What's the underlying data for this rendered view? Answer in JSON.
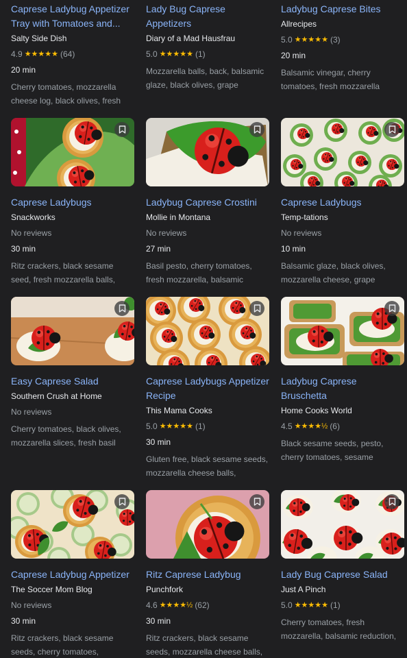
{
  "colors": {
    "background": "#1f1f21",
    "title": "#8ab4f8",
    "star": "#fbbc04",
    "muted": "#9aa0a6"
  },
  "recipes": [
    {
      "title": "Caprese Ladybug Appetizer Tray with Tomatoes and...",
      "source": "Salty Side Dish",
      "rating": "4.9",
      "stars": "★★★★★",
      "reviews": "(64)",
      "time": "20 min",
      "ingredients": "Cherry tomatoes, mozzarella cheese log, black olives, fresh",
      "image": "none"
    },
    {
      "title": "Lady Bug Caprese Appetizers",
      "source": "Diary of a Mad Hausfrau",
      "rating": "5.0",
      "stars": "★★★★★",
      "reviews": "(1)",
      "time": "",
      "ingredients": "Mozzarella balls, back, balsamic glaze, black olives, grape",
      "image": "none"
    },
    {
      "title": "Ladybug Caprese Bites",
      "source": "Allrecipes",
      "rating": "5.0",
      "stars": "★★★★★",
      "reviews": "(3)",
      "time": "20 min",
      "ingredients": "Balsamic vinegar, cherry tomatoes, fresh mozzarella",
      "image": "none"
    },
    {
      "title": "Caprese Ladybugs",
      "source": "Snackworks",
      "no_reviews": "No reviews",
      "time": "30 min",
      "ingredients": "Ritz crackers, black sesame seed, fresh mozzarella balls,",
      "image": "crackers-basil"
    },
    {
      "title": "Ladybug Caprese Crostini",
      "source": "Mollie in Montana",
      "no_reviews": "No reviews",
      "time": "27 min",
      "ingredients": "Basil pesto, cherry tomatoes, fresh mozzarella, balsamic",
      "image": "crostini-closeup"
    },
    {
      "title": "Caprese Ladybugs",
      "source": "Temp-tations",
      "no_reviews": "No reviews",
      "time": "10 min",
      "ingredients": "Balsamic glaze, black olives, mozzarella cheese, grape",
      "image": "platter-many"
    },
    {
      "title": "Easy Caprese Salad",
      "source": "Southern Crush at Home",
      "no_reviews": "No reviews",
      "time": "",
      "ingredients": "Cherry tomatoes, black olives, mozzarella slices, fresh basil",
      "image": "wood-board"
    },
    {
      "title": "Caprese Ladybugs Appetizer Recipe",
      "source": "This Mama Cooks",
      "rating": "5.0",
      "stars": "★★★★★",
      "reviews": "(1)",
      "time": "30 min",
      "ingredients": "Gluten free, black sesame seeds, mozzarella cheese balls,",
      "image": "crackers-yellow"
    },
    {
      "title": "Ladybug Caprese Bruschetta",
      "source": "Home Cooks World",
      "rating": "4.5",
      "stars": "★★★★½",
      "reviews": "(6)",
      "time": "",
      "ingredients": "Black sesame seeds, pesto, cherry tomatoes, sesame",
      "image": "bruschetta"
    },
    {
      "title": "Caprese Ladybug Appetizer",
      "source": "The Soccer Mom Blog",
      "no_reviews": "No reviews",
      "time": "30 min",
      "ingredients": "Ritz crackers, black sesame seeds, cherry tomatoes,",
      "image": "cucumber"
    },
    {
      "title": "Ritz Caprese Ladybug",
      "source": "Punchfork",
      "rating": "4.6",
      "stars": "★★★★½",
      "reviews": "(62)",
      "time": "30 min",
      "ingredients": "Ritz crackers, black sesame seeds, mozzarella cheese balls,",
      "image": "pink-cracker"
    },
    {
      "title": "Lady Bug Caprese Salad",
      "source": "Just A Pinch",
      "rating": "5.0",
      "stars": "★★★★★",
      "reviews": "(1)",
      "time": "",
      "ingredients": "Cherry tomatoes, fresh mozzarella, balsamic reduction,",
      "image": "white-plate"
    }
  ]
}
